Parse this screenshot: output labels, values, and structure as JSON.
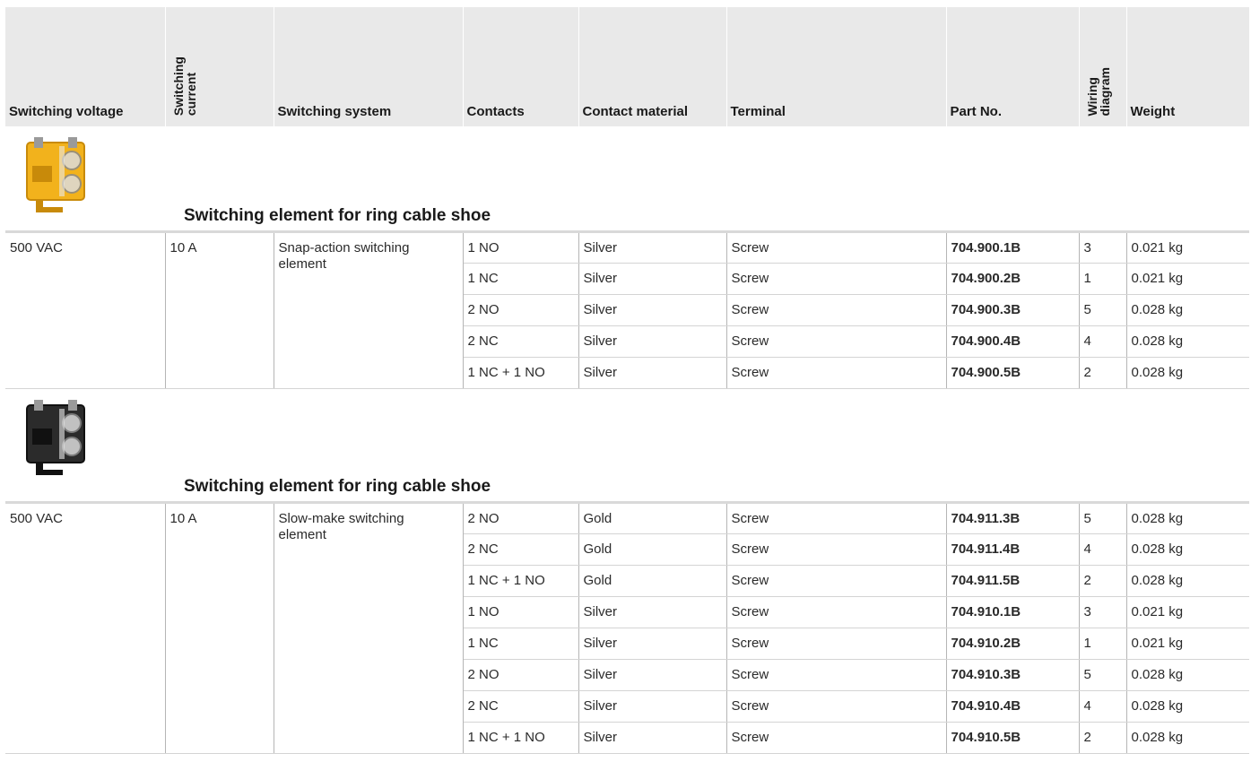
{
  "columns": [
    {
      "key": "switching_voltage",
      "label": "Switching voltage",
      "vertical": false
    },
    {
      "key": "switching_current",
      "label": "Switching\ncurrent",
      "vertical": true
    },
    {
      "key": "switching_system",
      "label": "Switching system",
      "vertical": false
    },
    {
      "key": "contacts",
      "label": "Contacts",
      "vertical": false
    },
    {
      "key": "contact_material",
      "label": "Contact material",
      "vertical": false
    },
    {
      "key": "terminal",
      "label": "Terminal",
      "vertical": false
    },
    {
      "key": "part_no",
      "label": "Part No.",
      "vertical": false
    },
    {
      "key": "wiring_diagram",
      "label": "Wiring\ndiagram",
      "vertical": true
    },
    {
      "key": "weight",
      "label": "Weight",
      "vertical": false
    }
  ],
  "sections": [
    {
      "title": "Switching element for ring cable shoe",
      "image_color": "yellow",
      "voltage": "500 VAC",
      "current": "10 A",
      "system": "Snap-action switching element",
      "rows": [
        {
          "contacts": "1 NO",
          "material": "Silver",
          "terminal": "Screw",
          "part_no": "704.900.1B",
          "wiring": "3",
          "weight": "0.021 kg"
        },
        {
          "contacts": "1 NC",
          "material": "Silver",
          "terminal": "Screw",
          "part_no": "704.900.2B",
          "wiring": "1",
          "weight": "0.021 kg"
        },
        {
          "contacts": "2 NO",
          "material": "Silver",
          "terminal": "Screw",
          "part_no": "704.900.3B",
          "wiring": "5",
          "weight": "0.028 kg"
        },
        {
          "contacts": "2 NC",
          "material": "Silver",
          "terminal": "Screw",
          "part_no": "704.900.4B",
          "wiring": "4",
          "weight": "0.028 kg"
        },
        {
          "contacts": "1 NC + 1 NO",
          "material": "Silver",
          "terminal": "Screw",
          "part_no": "704.900.5B",
          "wiring": "2",
          "weight": "0.028 kg"
        }
      ]
    },
    {
      "title": "Switching element for ring cable shoe",
      "image_color": "black",
      "voltage": "500 VAC",
      "current": "10 A",
      "system": "Slow-make switching element",
      "rows": [
        {
          "contacts": "2 NO",
          "material": "Gold",
          "terminal": "Screw",
          "part_no": "704.911.3B",
          "wiring": "5",
          "weight": "0.028 kg"
        },
        {
          "contacts": "2 NC",
          "material": "Gold",
          "terminal": "Screw",
          "part_no": "704.911.4B",
          "wiring": "4",
          "weight": "0.028 kg"
        },
        {
          "contacts": "1 NC + 1 NO",
          "material": "Gold",
          "terminal": "Screw",
          "part_no": "704.911.5B",
          "wiring": "2",
          "weight": "0.028 kg"
        },
        {
          "contacts": "1 NO",
          "material": "Silver",
          "terminal": "Screw",
          "part_no": "704.910.1B",
          "wiring": "3",
          "weight": "0.021 kg"
        },
        {
          "contacts": "1 NC",
          "material": "Silver",
          "terminal": "Screw",
          "part_no": "704.910.2B",
          "wiring": "1",
          "weight": "0.021 kg"
        },
        {
          "contacts": "2 NO",
          "material": "Silver",
          "terminal": "Screw",
          "part_no": "704.910.3B",
          "wiring": "5",
          "weight": "0.028 kg"
        },
        {
          "contacts": "2 NC",
          "material": "Silver",
          "terminal": "Screw",
          "part_no": "704.910.4B",
          "wiring": "4",
          "weight": "0.028 kg"
        },
        {
          "contacts": "1 NC + 1 NO",
          "material": "Silver",
          "terminal": "Screw",
          "part_no": "704.910.5B",
          "wiring": "2",
          "weight": "0.028 kg"
        }
      ]
    }
  ],
  "colors": {
    "header_bg": "#e9e9e9",
    "yellow_body": "#f2b21c",
    "black_body": "#2b2b2b"
  }
}
